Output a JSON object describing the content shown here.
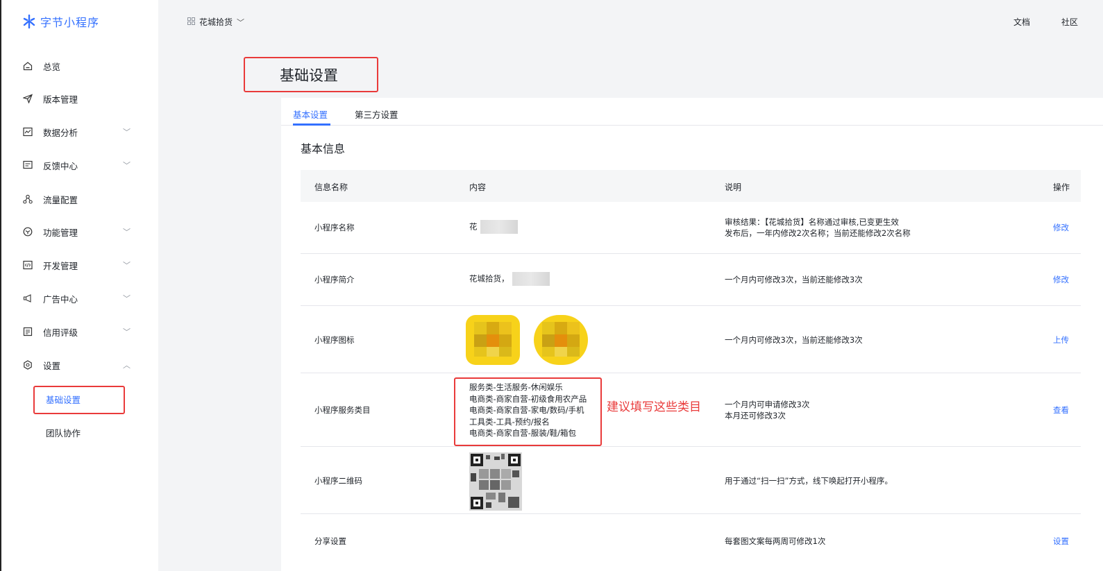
{
  "logo": {
    "text": "字节小程序"
  },
  "nav": [
    {
      "label": "总览",
      "icon": "home-icon",
      "chevron": ""
    },
    {
      "label": "版本管理",
      "icon": "send-icon",
      "chevron": ""
    },
    {
      "label": "数据分析",
      "icon": "chart-icon",
      "chevron": "﹀"
    },
    {
      "label": "反馈中心",
      "icon": "feedback-icon",
      "chevron": "﹀"
    },
    {
      "label": "流量配置",
      "icon": "flow-icon",
      "chevron": ""
    },
    {
      "label": "功能管理",
      "icon": "cube-icon",
      "chevron": "﹀"
    },
    {
      "label": "开发管理",
      "icon": "code-icon",
      "chevron": "﹀"
    },
    {
      "label": "广告中心",
      "icon": "megaphone-icon",
      "chevron": "﹀"
    },
    {
      "label": "信用评级",
      "icon": "rating-icon",
      "chevron": "﹀"
    },
    {
      "label": "设置",
      "icon": "gear-icon",
      "chevron": "︿"
    }
  ],
  "subnav": {
    "basic": "基础设置",
    "team": "团队协作"
  },
  "topbar": {
    "app_name": "花城拾货",
    "docs": "文档",
    "community": "社区"
  },
  "page_title": "基础设置",
  "tabs": {
    "basic": "基本设置",
    "third": "第三方设置"
  },
  "section_title": "基本信息",
  "table": {
    "headers": {
      "name": "信息名称",
      "content": "内容",
      "desc": "说明",
      "op": "操作"
    },
    "rows": [
      {
        "name": "小程序名称",
        "content": "花",
        "desc1": "审核结果：【花城拾货】名称通过审核,已变更生效",
        "desc2": "发布后，一年内修改2次名称；当前还能修改2次名称",
        "op": "修改"
      },
      {
        "name": "小程序简介",
        "content": "花城拾货，",
        "desc1": "一个月内可修改3次，当前还能修改3次",
        "op": "修改"
      },
      {
        "name": "小程序图标",
        "desc1": "一个月内可修改3次，当前还能修改3次",
        "op": "上传"
      },
      {
        "name": "小程序服务类目",
        "categories": [
          "服务类-生活服务-休闲娱乐",
          "电商类-商家自营-初级食用农产品",
          "电商类-商家自营-家电/数码/手机",
          "工具类-工具-预约/报名",
          "电商类-商家自营-服装/鞋/箱包"
        ],
        "desc1": "一个月内可申请修改3次",
        "desc2": "本月还可修改3次",
        "op": "查看"
      },
      {
        "name": "小程序二维码",
        "desc1": "用于通过“扫一扫”方式，线下唤起打开小程序。"
      },
      {
        "name": "分享设置",
        "desc1": "每套图文案每两周可修改1次",
        "op": "设置"
      }
    ]
  },
  "annotation": "建议填写这些类目",
  "colors": {
    "accent": "#3370ff",
    "highlight": "#e93a3a"
  }
}
